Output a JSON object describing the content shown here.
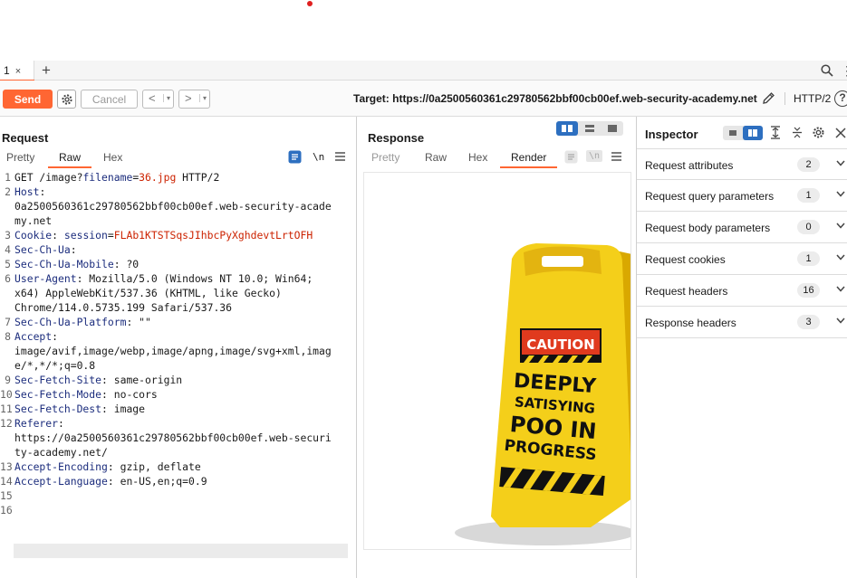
{
  "tabs": {
    "active_label": "1",
    "close_glyph": "×",
    "add_glyph": "+"
  },
  "toolbar": {
    "send_label": "Send",
    "cancel_label": "Cancel",
    "back_glyph": "<",
    "forward_glyph": ">",
    "dropdown_glyph": "▾",
    "target_text": "Target: https://0a2500560361c29780562bbf00cb00ef.web-security-academy.net",
    "http_version": "HTTP/2",
    "help_glyph": "?"
  },
  "request": {
    "title": "Request",
    "tabs": [
      "Pretty",
      "Raw",
      "Hex"
    ],
    "active_tab": "Raw",
    "wrap_label": "\\n",
    "line_numbers": [
      "1",
      "2",
      "",
      "",
      "3",
      "4",
      "5",
      "6",
      "",
      "",
      "7",
      "8",
      "",
      "",
      "9",
      "10",
      "11",
      "12",
      "",
      "",
      "13",
      "14",
      "15",
      "16"
    ],
    "lines": [
      {
        "parts": [
          {
            "t": "GET /image?",
            "c": ""
          },
          {
            "t": "filename",
            "c": "pk"
          },
          {
            "t": "=",
            "c": ""
          },
          {
            "t": "36.jpg",
            "c": "pv"
          },
          {
            "t": " HTTP/2",
            "c": ""
          }
        ]
      },
      {
        "parts": [
          {
            "t": "Host",
            "c": "hn"
          },
          {
            "t": ":",
            "c": ""
          }
        ]
      },
      {
        "parts": [
          {
            "t": "0a2500560361c29780562bbf00cb00ef.web-security-acade",
            "c": ""
          }
        ]
      },
      {
        "parts": [
          {
            "t": "my.net",
            "c": ""
          }
        ]
      },
      {
        "parts": [
          {
            "t": "Cookie",
            "c": "hn"
          },
          {
            "t": ": ",
            "c": ""
          },
          {
            "t": "session",
            "c": "pk"
          },
          {
            "t": "=",
            "c": ""
          },
          {
            "t": "FLAb1KTSTSqsJIhbcPyXghdevtLrtOFH",
            "c": "pv"
          }
        ]
      },
      {
        "parts": [
          {
            "t": "Sec-Ch-Ua",
            "c": "hn"
          },
          {
            "t": ":",
            "c": ""
          }
        ]
      },
      {
        "parts": [
          {
            "t": "Sec-Ch-Ua-Mobile",
            "c": "hn"
          },
          {
            "t": ": ?0",
            "c": ""
          }
        ]
      },
      {
        "parts": [
          {
            "t": "User-Agent",
            "c": "hn"
          },
          {
            "t": ": Mozilla/5.0 (Windows NT 10.0; Win64;",
            "c": ""
          }
        ]
      },
      {
        "parts": [
          {
            "t": "x64) AppleWebKit/537.36 (KHTML, like Gecko)",
            "c": ""
          }
        ]
      },
      {
        "parts": [
          {
            "t": "Chrome/114.0.5735.199 Safari/537.36",
            "c": ""
          }
        ]
      },
      {
        "parts": [
          {
            "t": "Sec-Ch-Ua-Platform",
            "c": "hn"
          },
          {
            "t": ": \"\"",
            "c": ""
          }
        ]
      },
      {
        "parts": [
          {
            "t": "Accept",
            "c": "hn"
          },
          {
            "t": ":",
            "c": ""
          }
        ]
      },
      {
        "parts": [
          {
            "t": "image/avif,image/webp,image/apng,image/svg+xml,imag",
            "c": ""
          }
        ]
      },
      {
        "parts": [
          {
            "t": "e/*,*/*;q=0.8",
            "c": ""
          }
        ]
      },
      {
        "parts": [
          {
            "t": "Sec-Fetch-Site",
            "c": "hn"
          },
          {
            "t": ": same-origin",
            "c": ""
          }
        ]
      },
      {
        "parts": [
          {
            "t": "Sec-Fetch-Mode",
            "c": "hn"
          },
          {
            "t": ": no-cors",
            "c": ""
          }
        ]
      },
      {
        "parts": [
          {
            "t": "Sec-Fetch-Dest",
            "c": "hn"
          },
          {
            "t": ": image",
            "c": ""
          }
        ]
      },
      {
        "parts": [
          {
            "t": "Referer",
            "c": "hn"
          },
          {
            "t": ":",
            "c": ""
          }
        ]
      },
      {
        "parts": [
          {
            "t": "https://0a2500560361c29780562bbf00cb00ef.web-securi",
            "c": ""
          }
        ]
      },
      {
        "parts": [
          {
            "t": "ty-academy.net/",
            "c": ""
          }
        ]
      },
      {
        "parts": [
          {
            "t": "Accept-Encoding",
            "c": "hn"
          },
          {
            "t": ": gzip, deflate",
            "c": ""
          }
        ]
      },
      {
        "parts": [
          {
            "t": "Accept-Language",
            "c": "hn"
          },
          {
            "t": ": en-US,en;q=0.9",
            "c": ""
          }
        ]
      },
      {
        "parts": []
      },
      {
        "parts": []
      }
    ]
  },
  "response": {
    "title": "Response",
    "tabs": [
      "Pretty",
      "Raw",
      "Hex",
      "Render"
    ],
    "active_tab": "Render",
    "wrap_label": "\\n",
    "sign_text": {
      "caution": "CAUTION",
      "line1": "DEEPLY",
      "line2": "SATISYING",
      "line3": "POO IN",
      "line4": "PROGRESS"
    }
  },
  "inspector": {
    "title": "Inspector",
    "rows": [
      {
        "label": "Request attributes",
        "count": "2"
      },
      {
        "label": "Request query parameters",
        "count": "1"
      },
      {
        "label": "Request body parameters",
        "count": "0"
      },
      {
        "label": "Request cookies",
        "count": "1"
      },
      {
        "label": "Request headers",
        "count": "16"
      },
      {
        "label": "Response headers",
        "count": "3"
      }
    ]
  },
  "colors": {
    "accent": "#ff6633",
    "toggle_on": "#2d6fc0",
    "header_name": "#1c2d7d",
    "param_value": "#cc2200",
    "sign_yellow": "#f4cf1a"
  }
}
